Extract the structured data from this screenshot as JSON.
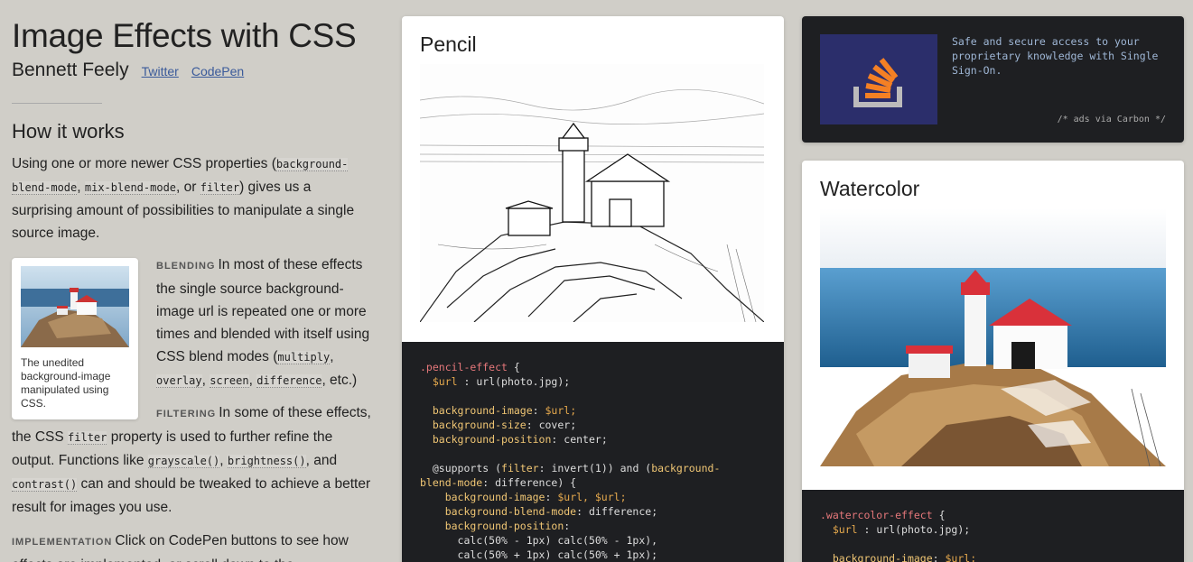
{
  "header": {
    "title": "Image Effects with CSS",
    "author": "Bennett Feely",
    "links": [
      "Twitter",
      "CodePen"
    ]
  },
  "how": {
    "title": "How it works",
    "intro": {
      "t1": "Using one or more newer CSS properties (",
      "c1": "background-blend-mode",
      "t2": ", ",
      "c2": "mix-blend-mode",
      "t3": ", or ",
      "c3": "filter",
      "t4": ") gives us a surprising amount of possibilities to manipulate a single source image."
    },
    "figure_caption": "The unedited background-image manipulated using CSS.",
    "blending": {
      "label": "BLENDING",
      "t1": "In most of these effects the single source background-image url is repeated one or more times and blended with itself using CSS blend modes (",
      "c1": "multiply",
      "t2": ", ",
      "c2": "overlay",
      "t3": ", ",
      "c3": "screen",
      "t4": ", ",
      "c4": "difference",
      "t5": ", etc.)"
    },
    "filtering": {
      "label": "FILTERING",
      "t1": "In some of these effects, the CSS ",
      "c1": "filter",
      "t2": " property is used to further refine the output. Functions like ",
      "c2": "grayscale()",
      "t3": ", ",
      "c3": "brightness()",
      "t4": ", and ",
      "c4": "contrast()",
      "t5": " can and should be tweaked to achieve a better result for images you use."
    },
    "implementation": {
      "label": "IMPLEMENTATION",
      "t1": "Click on CodePen buttons to see how effects are implemented, or scroll down to the"
    }
  },
  "ad": {
    "text": "Safe and secure access to your proprietary knowledge with Single Sign-On.",
    "credit": "/* ads via Carbon */",
    "logo_icon": "stack-overflow-icon"
  },
  "cards": {
    "pencil": {
      "title": "Pencil",
      "code": {
        "selector": ".pencil-effect",
        "url_var": "$url",
        "url_val": "url(photo.jpg);",
        "p1": "background-image",
        "v1": "$url;",
        "p2": "background-size",
        "v2": "cover;",
        "p3": "background-position",
        "v3": "center;",
        "supports_kw": "@supports",
        "supports_rest1": "(",
        "filter_kw": "filter",
        "supports_rest2": ": invert(1)) and (",
        "blend_kw": "background-",
        "blend_kw2": "blend-mode",
        "supports_rest3": ": difference) {",
        "p4": "background-image",
        "v4": "$url, $url;",
        "p5": "background-blend-mode",
        "v5": "difference;",
        "p6": "background-position",
        "calc1": "calc(50% - 1px) calc(50% - 1px),",
        "calc2": "calc(50% + 1px) calc(50% + 1px);"
      }
    },
    "watercolor": {
      "title": "Watercolor",
      "code": {
        "selector": ".watercolor-effect",
        "url_var": "$url",
        "url_val": "url(photo.jpg);",
        "p1": "background-image",
        "v1": "$url;"
      }
    }
  }
}
